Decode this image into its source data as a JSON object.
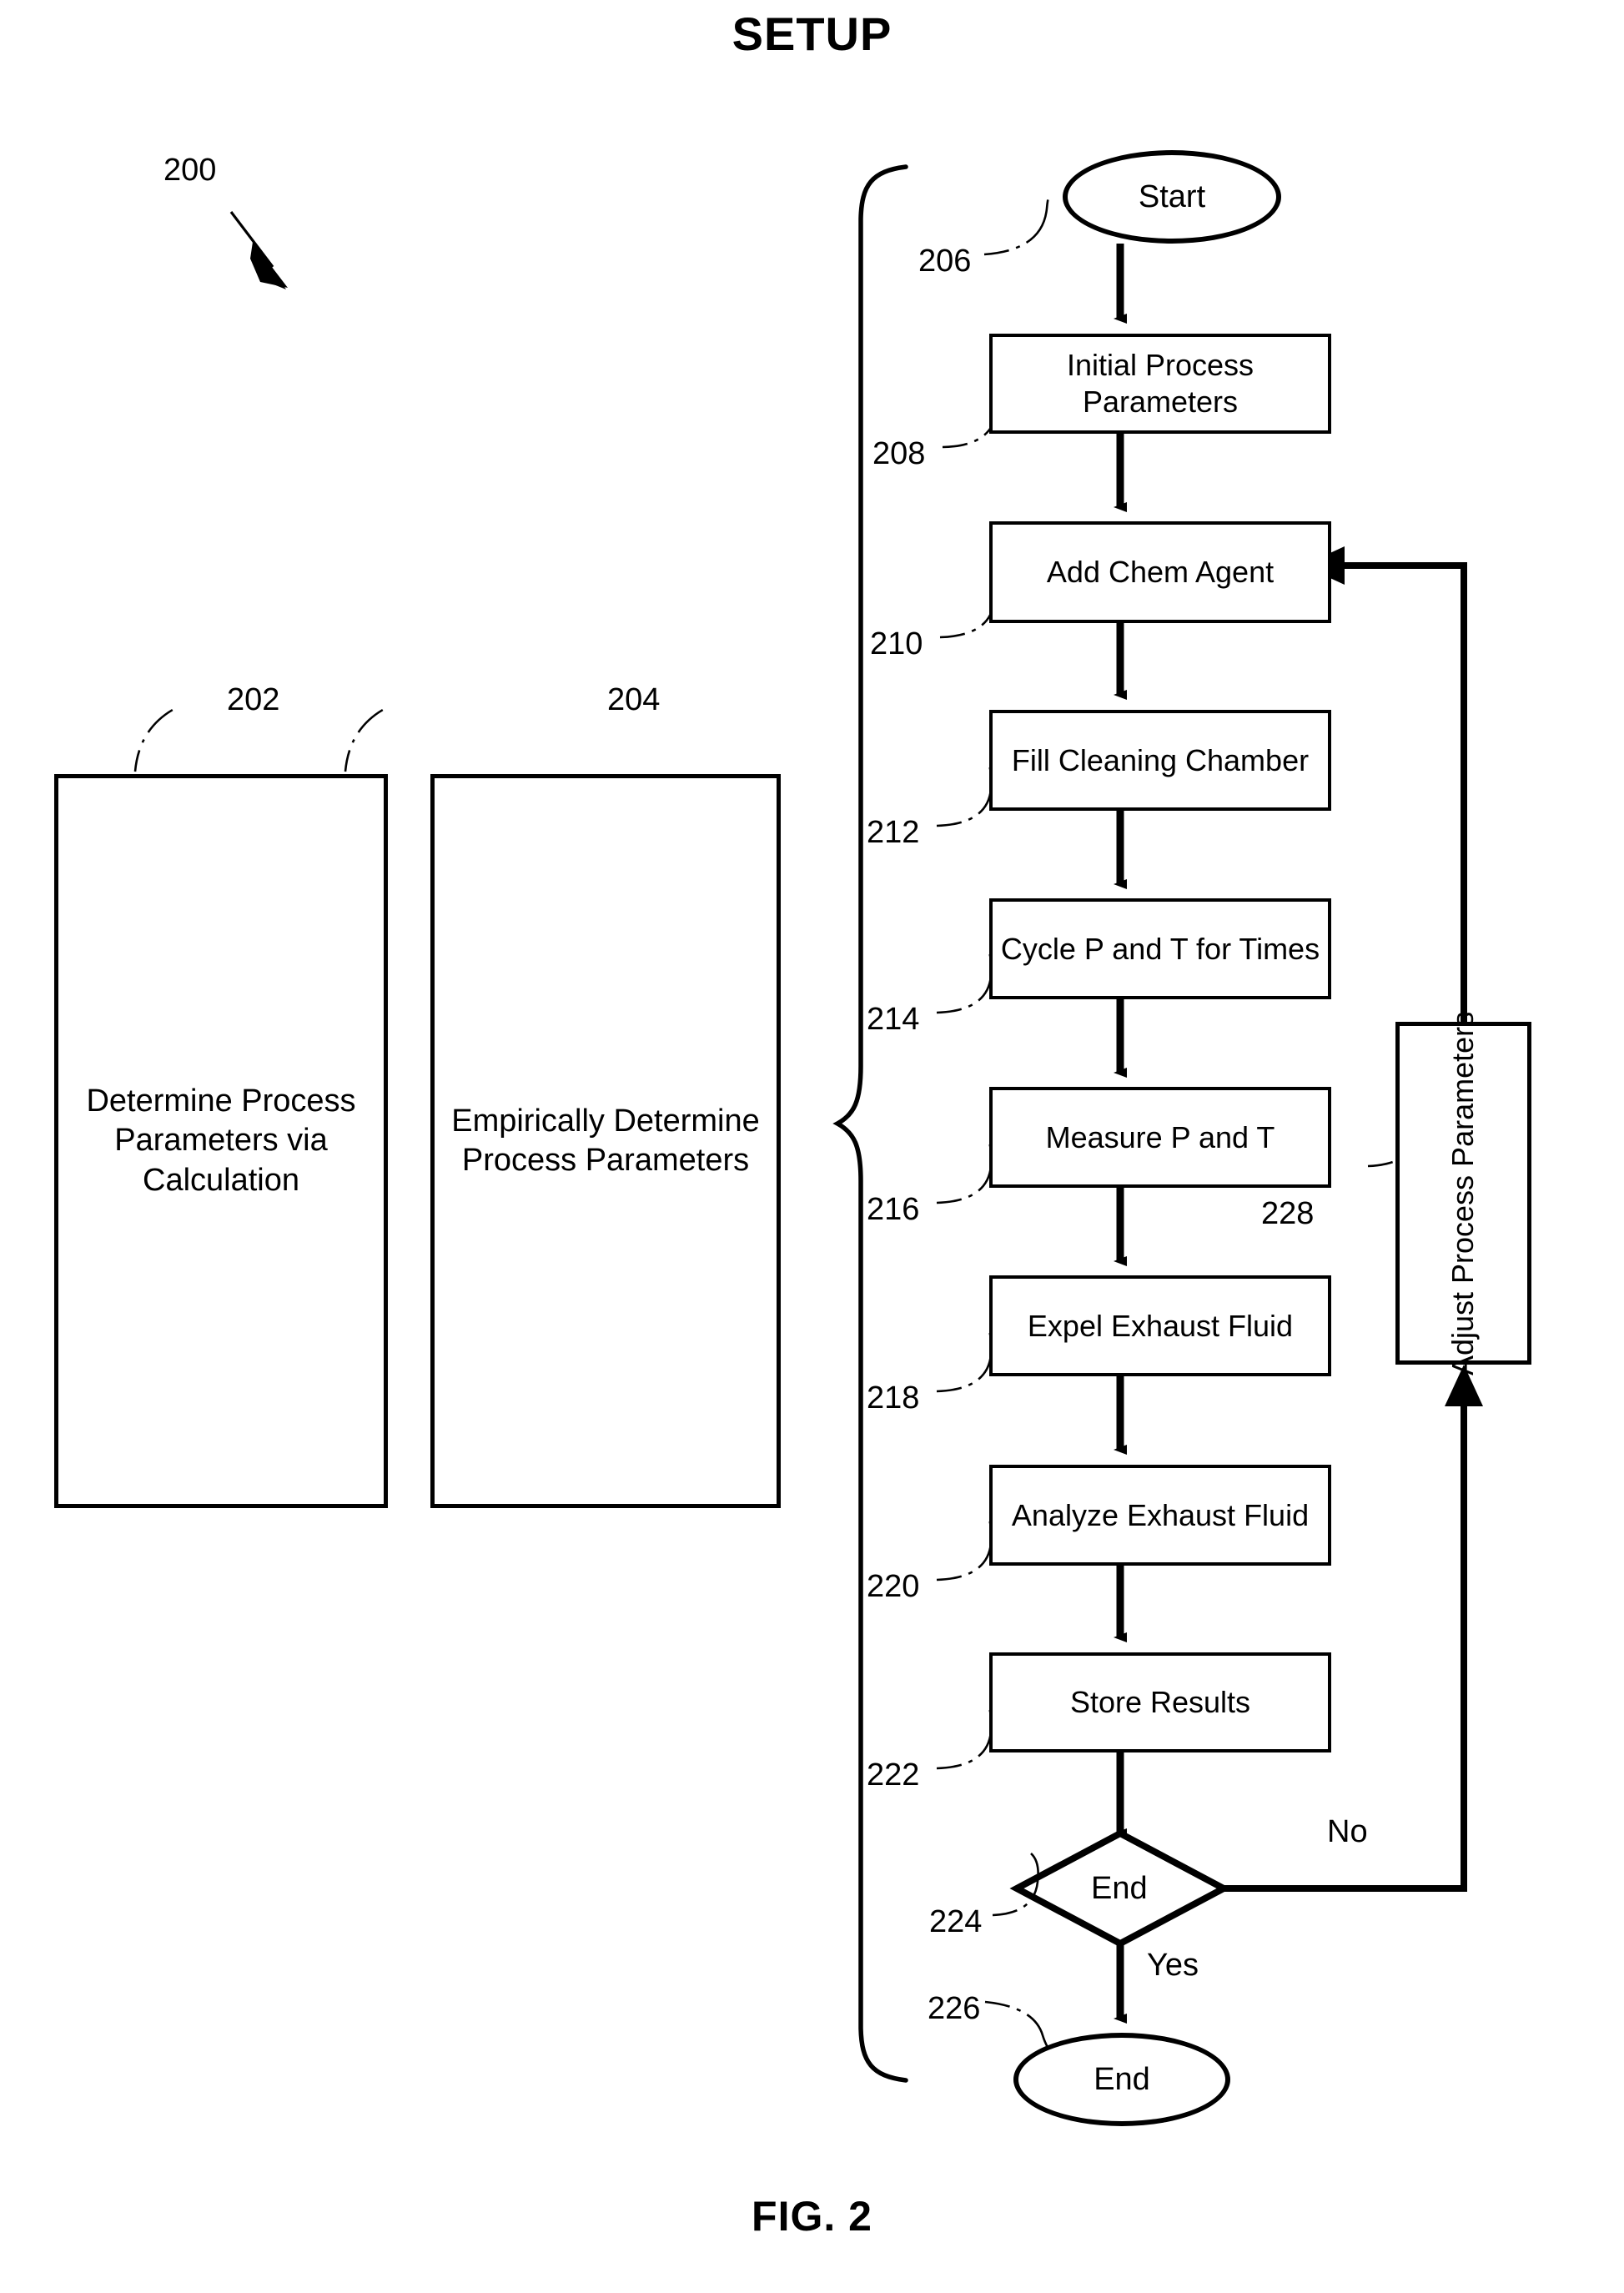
{
  "page": {
    "title": "SETUP",
    "figure_caption": "FIG. 2",
    "diagram_ref": "200"
  },
  "approaches": {
    "calculation": {
      "ref": "202",
      "label": "Determine Process Parameters via Calculation"
    },
    "empirical": {
      "ref": "204",
      "label": "Empirically Determine Process Parameters"
    }
  },
  "flowchart": {
    "nodes": [
      {
        "ref": "206",
        "label": "Start",
        "shape": "oval"
      },
      {
        "ref": "208",
        "label": "Initial Process Parameters",
        "shape": "process"
      },
      {
        "ref": "210",
        "label": "Add Chem Agent",
        "shape": "process"
      },
      {
        "ref": "212",
        "label": "Fill Cleaning Chamber",
        "shape": "process"
      },
      {
        "ref": "214",
        "label": "Cycle P and T for Times",
        "shape": "process"
      },
      {
        "ref": "216",
        "label": "Measure P and T",
        "shape": "process"
      },
      {
        "ref": "218",
        "label": "Expel Exhaust Fluid",
        "shape": "process"
      },
      {
        "ref": "220",
        "label": "Analyze  Exhaust Fluid",
        "shape": "process"
      },
      {
        "ref": "222",
        "label": "Store Results",
        "shape": "process"
      },
      {
        "ref": "224",
        "label": "End",
        "shape": "decision"
      },
      {
        "ref": "226",
        "label": "End",
        "shape": "oval"
      }
    ],
    "feedback": {
      "ref": "228",
      "label": "Adjust Process Parameters"
    },
    "branch_labels": {
      "no": "No",
      "yes": "Yes"
    }
  },
  "colors": {
    "ink": "#000000",
    "paper": "#ffffff"
  }
}
